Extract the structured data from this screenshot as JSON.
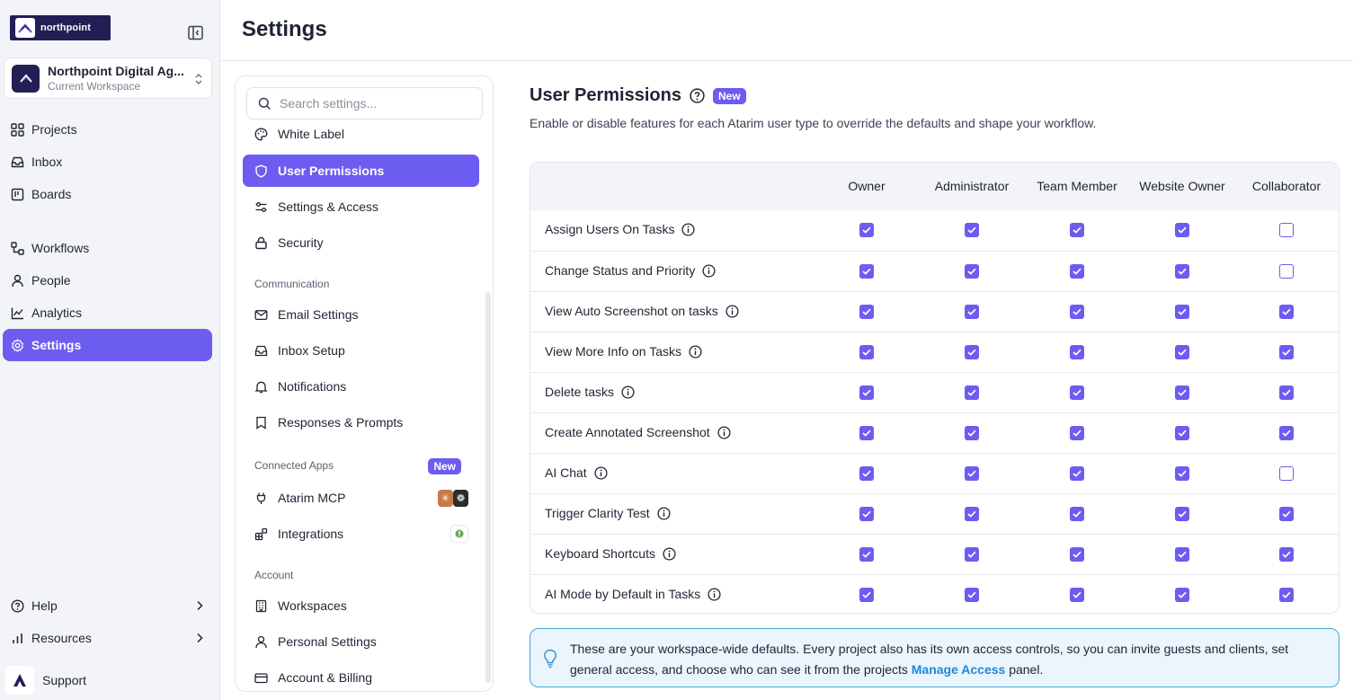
{
  "brand": {
    "logo_text": "northpoint",
    "workspace_name": "Northpoint Digital Ag...",
    "workspace_sub": "Current Workspace"
  },
  "colors": {
    "accent": "#6d5cf0",
    "brand_dark": "#221f55",
    "info_border": "#4aa6d8",
    "info_bg": "#eaf5fd",
    "link": "#1e88d8"
  },
  "sidebar": {
    "nav_top": [
      {
        "label": "Projects",
        "icon": "grid-icon"
      },
      {
        "label": "Inbox",
        "icon": "inbox-icon"
      },
      {
        "label": "Boards",
        "icon": "board-icon"
      }
    ],
    "nav_mid": [
      {
        "label": "Workflows",
        "icon": "workflow-icon"
      },
      {
        "label": "People",
        "icon": "person-icon"
      },
      {
        "label": "Analytics",
        "icon": "chart-icon"
      },
      {
        "label": "Settings",
        "icon": "gear-icon",
        "active": true
      }
    ],
    "nav_bottom": [
      {
        "label": "Help",
        "icon": "help-icon"
      },
      {
        "label": "Resources",
        "icon": "bars-icon"
      }
    ],
    "support_label": "Support"
  },
  "header": {
    "title": "Settings"
  },
  "settings_nav": {
    "search_placeholder": "Search settings...",
    "items_top": [
      {
        "label": "White Label",
        "icon": "palette-icon"
      },
      {
        "label": "User Permissions",
        "icon": "shield-icon",
        "active": true
      },
      {
        "label": "Settings & Access",
        "icon": "sliders-icon"
      },
      {
        "label": "Security",
        "icon": "lock-icon"
      }
    ],
    "group_communication": "Communication",
    "items_communication": [
      {
        "label": "Email Settings",
        "icon": "mail-icon"
      },
      {
        "label": "Inbox Setup",
        "icon": "inbox-icon"
      },
      {
        "label": "Notifications",
        "icon": "bell-icon"
      },
      {
        "label": "Responses & Prompts",
        "icon": "bookmark-icon"
      }
    ],
    "group_connected": "Connected Apps",
    "group_connected_badge": "New",
    "items_connected": [
      {
        "label": "Atarim MCP",
        "icon": "plug-icon"
      },
      {
        "label": "Integrations",
        "icon": "blocks-icon"
      }
    ],
    "group_account": "Account",
    "items_account": [
      {
        "label": "Workspaces",
        "icon": "building-icon"
      },
      {
        "label": "Personal Settings",
        "icon": "user-icon"
      },
      {
        "label": "Account & Billing",
        "icon": "card-icon"
      }
    ]
  },
  "permissions": {
    "title": "User Permissions",
    "badge": "New",
    "description": "Enable or disable features for each Atarim user type to override the defaults and shape your workflow.",
    "columns": [
      "Owner",
      "Administrator",
      "Team Member",
      "Website Owner",
      "Collaborator"
    ],
    "rows": [
      {
        "label": "Assign Users On Tasks",
        "values": [
          true,
          true,
          true,
          true,
          false
        ]
      },
      {
        "label": "Change Status and Priority",
        "values": [
          true,
          true,
          true,
          true,
          false
        ]
      },
      {
        "label": "View Auto Screenshot on tasks",
        "values": [
          true,
          true,
          true,
          true,
          true
        ]
      },
      {
        "label": "View More Info on Tasks",
        "values": [
          true,
          true,
          true,
          true,
          true
        ]
      },
      {
        "label": "Delete tasks",
        "values": [
          true,
          true,
          true,
          true,
          true
        ]
      },
      {
        "label": "Create Annotated Screenshot",
        "values": [
          true,
          true,
          true,
          true,
          true
        ]
      },
      {
        "label": "AI Chat",
        "values": [
          true,
          true,
          true,
          true,
          false
        ]
      },
      {
        "label": "Trigger Clarity Test",
        "values": [
          true,
          true,
          true,
          true,
          true
        ]
      },
      {
        "label": "Keyboard Shortcuts",
        "values": [
          true,
          true,
          true,
          true,
          true
        ]
      },
      {
        "label": "AI Mode by Default in Tasks",
        "values": [
          true,
          true,
          true,
          true,
          true
        ]
      }
    ]
  },
  "notice": {
    "text": "These are your workspace-wide defaults. Every project also has its own access controls, so you can invite guests and clients, set general access, and choose who can see it from the projects ",
    "link": "Manage Access",
    "suffix": " panel."
  }
}
